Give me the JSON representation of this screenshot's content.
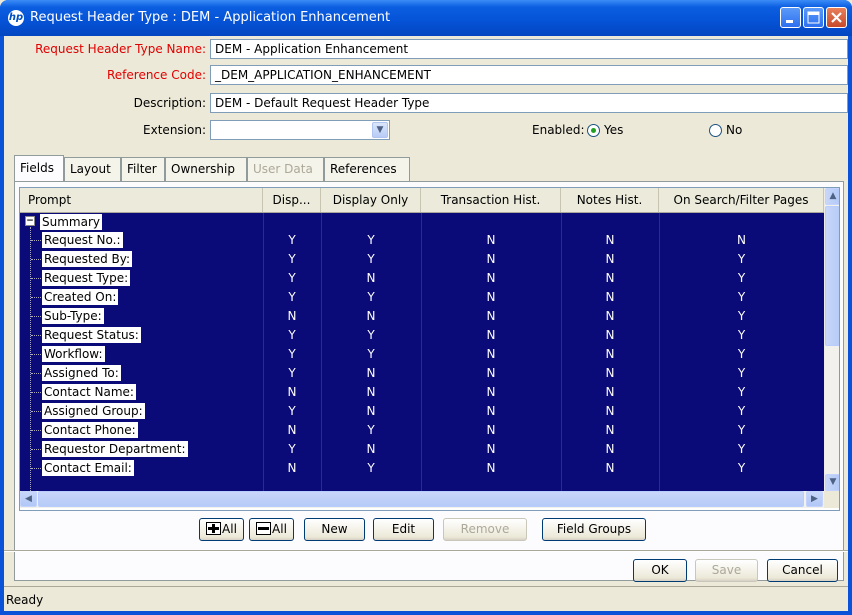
{
  "window": {
    "title": "Request Header Type : DEM - Application Enhancement",
    "icon": "hp-logo-icon",
    "controls": [
      "minimize",
      "maximize",
      "close"
    ]
  },
  "form": {
    "name_label": "Request Header Type Name:",
    "name_value": "DEM - Application Enhancement",
    "code_label": "Reference Code:",
    "code_value": "_DEM_APPLICATION_ENHANCEMENT",
    "desc_label": "Description:",
    "desc_value": "DEM - Default Request Header Type",
    "ext_label": "Extension:",
    "ext_value": "",
    "enabled_label": "Enabled:",
    "enabled_yes": "Yes",
    "enabled_no": "No",
    "enabled_selected": "Yes"
  },
  "tabs": [
    {
      "label": "Fields",
      "active": true
    },
    {
      "label": "Layout"
    },
    {
      "label": "Filter"
    },
    {
      "label": "Ownership"
    },
    {
      "label": "User Data",
      "disabled": true
    },
    {
      "label": "References"
    }
  ],
  "grid": {
    "columns": [
      "Prompt",
      "Disp...",
      "Display Only",
      "Transaction Hist.",
      "Notes Hist.",
      "On Search/Filter Pages"
    ],
    "group": "Summary",
    "rows": [
      {
        "prompt": "Request No.:",
        "disp": "Y",
        "display_only": "Y",
        "trans": "N",
        "notes": "N",
        "search": "N"
      },
      {
        "prompt": "Requested By:",
        "disp": "Y",
        "display_only": "Y",
        "trans": "N",
        "notes": "N",
        "search": "Y"
      },
      {
        "prompt": "Request Type:",
        "disp": "Y",
        "display_only": "N",
        "trans": "N",
        "notes": "N",
        "search": "Y"
      },
      {
        "prompt": "Created On:",
        "disp": "Y",
        "display_only": "Y",
        "trans": "N",
        "notes": "N",
        "search": "Y"
      },
      {
        "prompt": "Sub-Type:",
        "disp": "N",
        "display_only": "N",
        "trans": "N",
        "notes": "N",
        "search": "Y"
      },
      {
        "prompt": "Request Status:",
        "disp": "Y",
        "display_only": "Y",
        "trans": "N",
        "notes": "N",
        "search": "Y"
      },
      {
        "prompt": "Workflow:",
        "disp": "Y",
        "display_only": "Y",
        "trans": "N",
        "notes": "N",
        "search": "Y"
      },
      {
        "prompt": "Assigned To:",
        "disp": "Y",
        "display_only": "N",
        "trans": "N",
        "notes": "N",
        "search": "Y"
      },
      {
        "prompt": "Contact Name:",
        "disp": "N",
        "display_only": "N",
        "trans": "N",
        "notes": "N",
        "search": "Y"
      },
      {
        "prompt": "Assigned Group:",
        "disp": "Y",
        "display_only": "N",
        "trans": "N",
        "notes": "N",
        "search": "Y"
      },
      {
        "prompt": "Contact Phone:",
        "disp": "N",
        "display_only": "Y",
        "trans": "N",
        "notes": "N",
        "search": "Y"
      },
      {
        "prompt": "Requestor Department:",
        "disp": "Y",
        "display_only": "N",
        "trans": "N",
        "notes": "N",
        "search": "Y"
      },
      {
        "prompt": "Contact Email:",
        "disp": "N",
        "display_only": "Y",
        "trans": "N",
        "notes": "N",
        "search": "Y"
      }
    ]
  },
  "grid_buttons": {
    "expand_all": "All",
    "collapse_all": "All",
    "new": "New",
    "edit": "Edit",
    "remove": "Remove",
    "field_groups": "Field Groups"
  },
  "dialog_buttons": {
    "ok": "OK",
    "save": "Save",
    "cancel": "Cancel"
  },
  "status": "Ready",
  "colors": {
    "selection": "#0a0a78",
    "required_label": "#e00000",
    "titlebar": "#0552d6"
  }
}
